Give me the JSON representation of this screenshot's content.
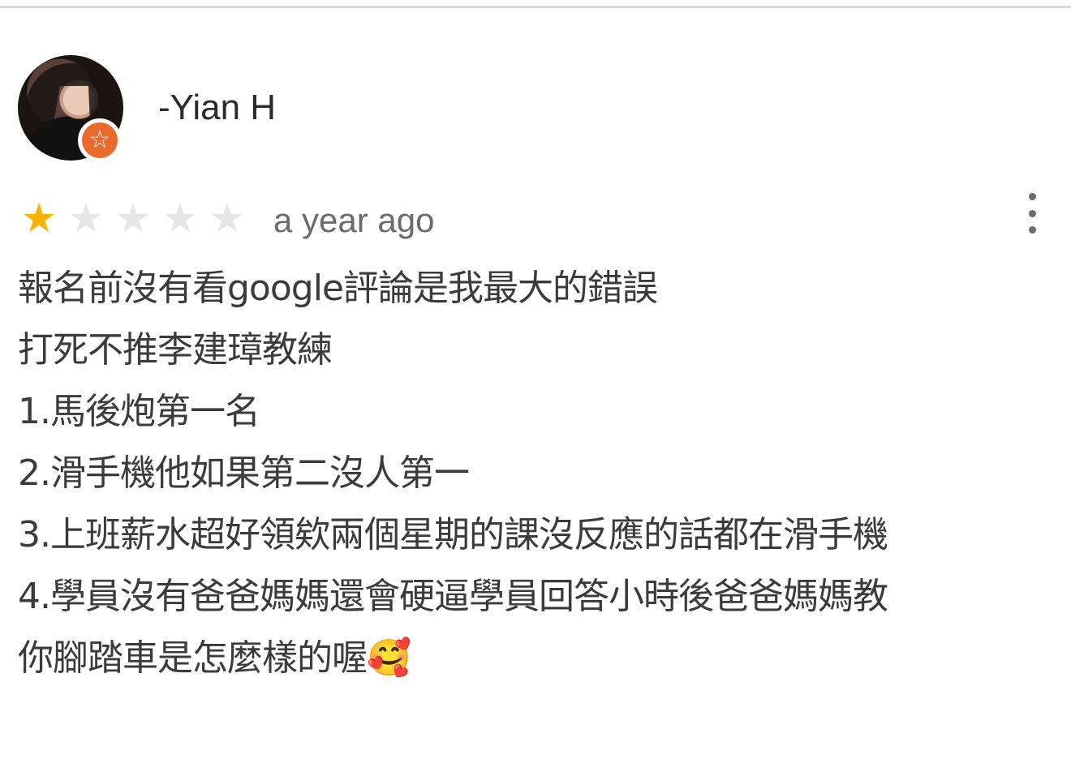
{
  "review": {
    "author": "-Yian H",
    "rating": 1,
    "rating_max": 5,
    "time": "a year ago",
    "lines": [
      "報名前沒有看google評論是我最大的錯誤",
      "打死不推李建璋教練",
      "1.馬後炮第一名",
      "2.滑手機他如果第二沒人第一",
      "3.上班薪水超好領欸兩個星期的課沒反應的話都在滑手機",
      "4.學員沒有爸爸媽媽還會硬逼學員回答小時後爸爸媽媽教",
      "你腳踏車是怎麼樣的喔🥰"
    ]
  },
  "colors": {
    "star_filled": "#f6b400",
    "star_empty": "#e6e6e6",
    "badge": "#ea6a2b"
  },
  "icons": {
    "more": "more-vert-icon",
    "badge": "local-guide-star-icon"
  }
}
